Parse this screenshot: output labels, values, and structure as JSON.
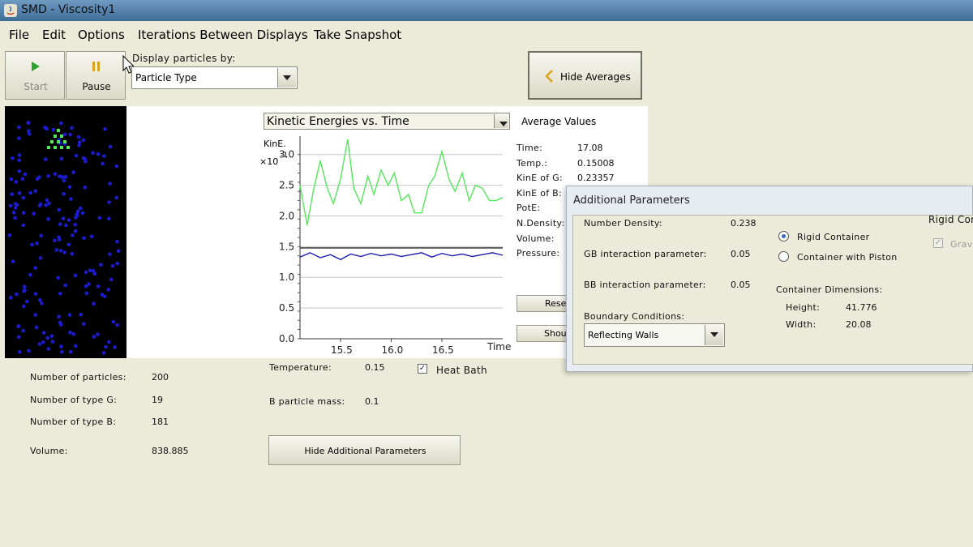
{
  "window": {
    "title": "SMD - Viscosity1"
  },
  "menu": [
    "File",
    "Edit",
    "Options",
    "Iterations Between Displays",
    "Take Snapshot"
  ],
  "toolbar": {
    "start": "Start",
    "pause": "Pause"
  },
  "display": {
    "label": "Display particles by:",
    "selected": "Particle Type"
  },
  "averages_button": "Hide Averages",
  "graph": {
    "selector": "Kinetic Energies vs. Time",
    "y_label": "KinE.",
    "y_scale": "×10",
    "y_exp": "-1",
    "y_ticks": [
      "3.0",
      "2.5",
      "2.0",
      "1.5",
      "1.0",
      "0.5",
      "0.0"
    ],
    "x_ticks": [
      "15.5",
      "16.0",
      "16.5"
    ],
    "x_label": "Time"
  },
  "averages": {
    "title": "Average Values",
    "rows": [
      {
        "label": "Time:",
        "value": "17.08"
      },
      {
        "label": "Temp.:",
        "value": "0.15008"
      },
      {
        "label": "KinE of G:",
        "value": "0.23357"
      },
      {
        "label": "KinE of B:",
        "value": ""
      },
      {
        "label": "PotE:",
        "value": ""
      },
      {
        "label": "N.Density:",
        "value": ""
      },
      {
        "label": "Volume:",
        "value": ""
      },
      {
        "label": "Pressure:",
        "value": ""
      }
    ],
    "reset_button": "Rese",
    "show_button": "Shou"
  },
  "stats": {
    "rows": [
      {
        "label": "Number of particles:",
        "value": "200"
      },
      {
        "label": "Number of type G:",
        "value": "19"
      },
      {
        "label": "Number of type B:",
        "value": "181"
      }
    ],
    "volume_label": "Volume:",
    "volume_value": "838.885"
  },
  "controls": {
    "temperature_label": "Temperature:",
    "temperature_value": "0.15",
    "heat_bath": "Heat Bath",
    "heat_bath_checked": true,
    "bmass_label": "B particle mass:",
    "bmass_value": "0.1",
    "hide_params_button": "Hide Additional Parameters"
  },
  "additional": {
    "title": "Additional Parameters",
    "number_density_label": "Number Density:",
    "number_density_value": "0.238",
    "gb_label": "GB interaction parameter:",
    "gb_value": "0.05",
    "bb_label": "BB interaction parameter:",
    "bb_value": "0.05",
    "boundary_label": "Boundary Conditions:",
    "boundary_selected": "Reflecting Walls",
    "rigid_radio": "Rigid Container",
    "piston_radio": "Container with Piston",
    "dims_label": "Container Dimensions:",
    "height_label": "Height:",
    "height_value": "41.776",
    "width_label": "Width:",
    "width_value": "20.08",
    "right_header": "Rigid Con",
    "gravity_label": "Grav"
  },
  "colors": {
    "green": "#52e85a",
    "blue": "#1b1bd0",
    "accent": "#3d6bb5"
  },
  "chart_data": {
    "type": "line",
    "title": "Kinetic Energies vs. Time",
    "xlabel": "Time",
    "ylabel": "KinE.",
    "xlim": [
      15.1,
      17.1
    ],
    "ylim": [
      0.0,
      3.3
    ],
    "grid": true,
    "series": [
      {
        "color": "#52e85a",
        "x": [
          15.1,
          15.17,
          15.23,
          15.3,
          15.37,
          15.43,
          15.5,
          15.57,
          15.63,
          15.7,
          15.77,
          15.83,
          15.9,
          15.97,
          16.03,
          16.1,
          16.17,
          16.23,
          16.3,
          16.37,
          16.43,
          16.5,
          16.57,
          16.63,
          16.7,
          16.77,
          16.83,
          16.9,
          16.97,
          17.03,
          17.1
        ],
        "y": [
          2.5,
          1.85,
          2.4,
          2.9,
          2.45,
          2.2,
          2.6,
          3.25,
          2.45,
          2.2,
          2.65,
          2.35,
          2.75,
          2.5,
          2.7,
          2.25,
          2.35,
          2.05,
          2.05,
          2.5,
          2.65,
          3.05,
          2.6,
          2.4,
          2.7,
          2.25,
          2.5,
          2.45,
          2.25,
          2.25,
          2.3
        ]
      },
      {
        "color": "#222222",
        "x": [
          15.1,
          17.1
        ],
        "y": [
          1.48,
          1.48
        ]
      },
      {
        "color": "#2020b0",
        "x": [
          15.1,
          15.2,
          15.3,
          15.4,
          15.5,
          15.6,
          15.7,
          15.8,
          15.9,
          16.0,
          16.1,
          16.2,
          16.3,
          16.4,
          16.5,
          16.6,
          16.7,
          16.8,
          16.9,
          17.0,
          17.1
        ],
        "y": [
          1.33,
          1.4,
          1.32,
          1.37,
          1.29,
          1.38,
          1.34,
          1.39,
          1.35,
          1.38,
          1.34,
          1.37,
          1.4,
          1.33,
          1.39,
          1.35,
          1.38,
          1.34,
          1.37,
          1.4,
          1.36
        ]
      }
    ]
  }
}
